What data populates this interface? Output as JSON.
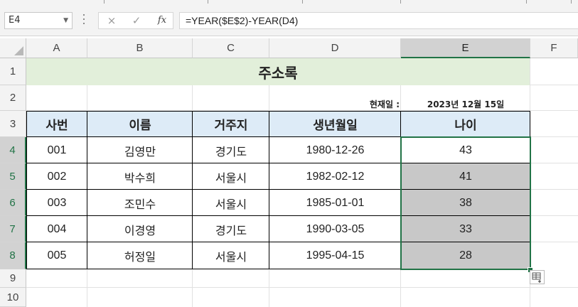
{
  "formula_bar": {
    "name_box": "E4",
    "cancel_icon": "×",
    "enter_icon": "✓",
    "fx_label": "fx",
    "formula": "=YEAR($E$2)-YEAR(D4)"
  },
  "columns": [
    "A",
    "B",
    "C",
    "D",
    "E",
    "F"
  ],
  "rows": [
    "1",
    "2",
    "3",
    "4",
    "5",
    "6",
    "7",
    "8",
    "9",
    "10"
  ],
  "sheet": {
    "title": "주소록",
    "current_date_label": "현재일 :",
    "current_date_value": "2023년 12월 15일",
    "table_headers": [
      "사번",
      "이름",
      "거주지",
      "생년월일",
      "나이"
    ],
    "table_rows": [
      [
        "001",
        "김영만",
        "경기도",
        "1980-12-26",
        "43"
      ],
      [
        "002",
        "박수희",
        "서울시",
        "1982-02-12",
        "41"
      ],
      [
        "003",
        "조민수",
        "서울시",
        "1985-01-01",
        "38"
      ],
      [
        "004",
        "이경영",
        "경기도",
        "1990-03-05",
        "33"
      ],
      [
        "005",
        "허정일",
        "서울시",
        "1995-04-15",
        "28"
      ]
    ]
  },
  "colors": {
    "title_fill": "#e2efda",
    "header_fill": "#ddebf7",
    "selection": "#217346",
    "filled_cells": "#c8c8c8"
  },
  "icons": {
    "quick_analysis": "quick-analysis-icon",
    "fill_handle": "fill-handle-icon"
  }
}
